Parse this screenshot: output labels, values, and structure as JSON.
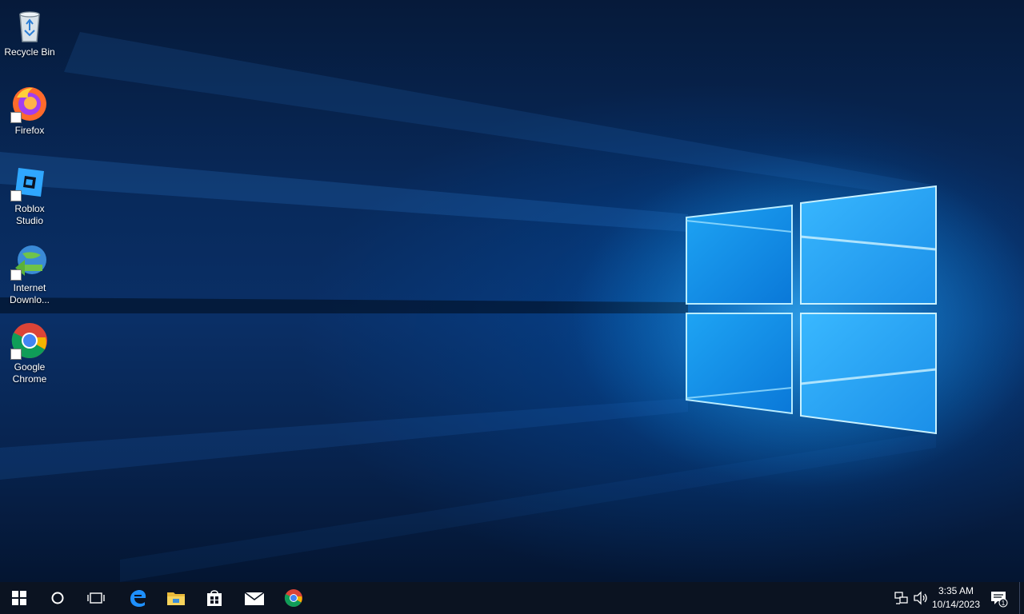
{
  "desktop": {
    "icons": [
      {
        "label": "Recycle Bin",
        "icon": "recycle-bin-icon"
      },
      {
        "label": "Firefox",
        "icon": "firefox-icon"
      },
      {
        "label": "Roblox\nStudio",
        "icon": "roblox-studio-icon"
      },
      {
        "label": "Internet\nDownlo...",
        "icon": "internet-download-manager-icon"
      },
      {
        "label": "Google\nChrome",
        "icon": "google-chrome-icon"
      }
    ]
  },
  "taskbar": {
    "buttons": [
      {
        "name": "start",
        "icon": "windows-logo-icon"
      },
      {
        "name": "search",
        "icon": "cortana-circle-icon"
      },
      {
        "name": "task-view",
        "icon": "task-view-icon"
      },
      {
        "name": "edge",
        "icon": "edge-icon"
      },
      {
        "name": "file-explorer",
        "icon": "folder-icon"
      },
      {
        "name": "store",
        "icon": "store-bag-icon"
      },
      {
        "name": "mail",
        "icon": "mail-icon"
      },
      {
        "name": "chrome",
        "icon": "chrome-icon"
      }
    ],
    "tray": {
      "time": "3:35 AM",
      "date": "10/14/2023",
      "notification_count": "1",
      "icons": [
        "network-icon",
        "volume-icon",
        "action-center-icon"
      ]
    }
  },
  "colors": {
    "taskbar": "#0b1321",
    "accent": "#0078d7",
    "glow": "#3fb4ff"
  }
}
